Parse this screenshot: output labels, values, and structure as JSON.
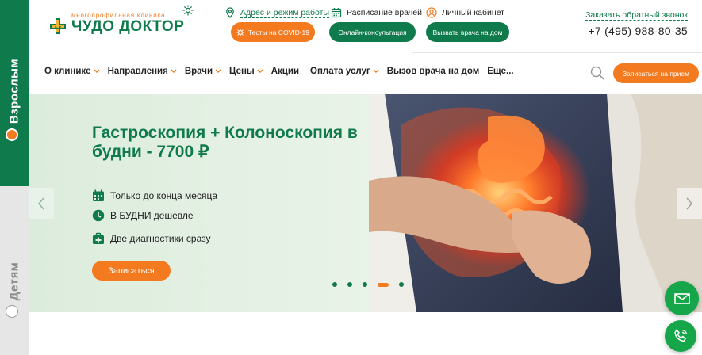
{
  "sidebar": {
    "adult_label": "Взрослым",
    "kids_label": "Детям"
  },
  "logo": {
    "small": "многопрофильная клиника",
    "big": "ЧУДО ДОКТОР"
  },
  "header": {
    "address_link": "Адрес и режим работы",
    "schedule_link": "Расписание врачей",
    "cabinet_link": "Личный кабинет",
    "covid_button": "Тесты на COVID-19",
    "online_button": "Онлайн-консультация",
    "home_doctor_button": "Вызвать врача на дом",
    "callback_link": "Заказать обратный звонок",
    "phone": "+7 (495) 988-80-35"
  },
  "nav": {
    "items": [
      {
        "label": "О клинике",
        "dropdown": true
      },
      {
        "label": "Направления",
        "dropdown": true
      },
      {
        "label": "Врачи",
        "dropdown": true
      },
      {
        "label": "Цены",
        "dropdown": true
      },
      {
        "label": "Акции",
        "dropdown": false
      },
      {
        "label": "Оплата услуг",
        "dropdown": true
      },
      {
        "label": "Вызов врача на дом",
        "dropdown": false
      },
      {
        "label": "Еще...",
        "dropdown": false
      }
    ],
    "book_button": "Записаться на прием"
  },
  "hero": {
    "title": "Гастроскопия + Колоноскопия в будни - 7700 ₽",
    "features": [
      {
        "icon": "calendar-icon",
        "text": "Только до конца месяца"
      },
      {
        "icon": "clock-icon",
        "text": "В БУДНИ дешевле"
      },
      {
        "icon": "medical-kit-icon",
        "text": "Две диагностики сразу"
      }
    ],
    "button": "Записаться",
    "slides_total": 5,
    "active_slide": 4
  },
  "colors": {
    "brand_green": "#0f7a4b",
    "accent_orange": "#f47a20",
    "fab_green": "#16a64a"
  },
  "icons": [
    "location-pin-icon",
    "calendar-icon",
    "user-icon",
    "sun-icon",
    "search-icon",
    "mail-icon",
    "phone-icon",
    "chevron-down-icon",
    "arrow-left-icon",
    "arrow-right-icon"
  ]
}
